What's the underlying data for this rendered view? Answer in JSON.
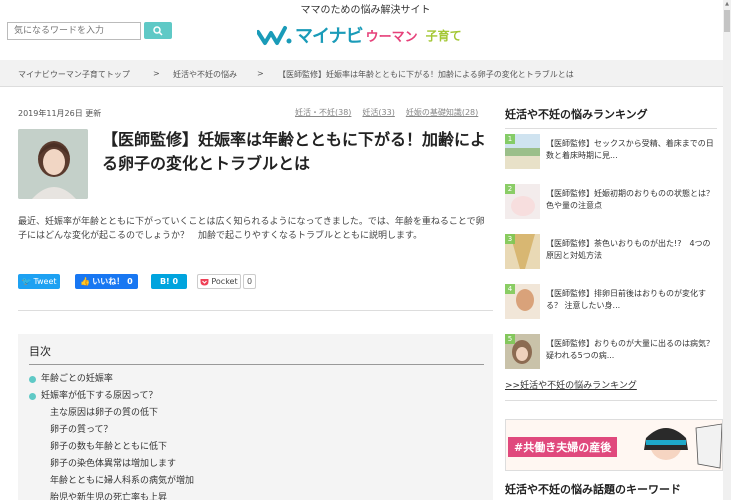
{
  "header": {
    "tagline": "ママのための悩み解決サイト",
    "search_placeholder": "気になるワードを入力",
    "logo_main": "マイナビ",
    "logo_woman": "ウーマン",
    "logo_kosodate": "子育て"
  },
  "breadcrumb": [
    "マイナビウーマン子育てトップ",
    ">",
    "妊活や不妊の悩み",
    ">",
    "【医師監修】妊娠率は年齢とともに下がる！加齢による卵子の変化とトラブルとは"
  ],
  "article": {
    "date": "2019年11月26日 更新",
    "tags": [
      "妊活・不妊(38)",
      "妊活(33)",
      "妊娠の基礎知識(28)"
    ],
    "title": "【医師監修】妊娠率は年齢とともに下がる！加齢による卵子の変化とトラブルとは",
    "lead": "最近、妊娠率が年齢とともに下がっていくことは広く知られるようになってきました。では、年齢を重ねることで卵子にはどんな変化が起こるのでしょうか？　加齢で起こりやすくなるトラブルとともに説明します。"
  },
  "share": {
    "tweet": "Tweet",
    "like": "いいね！ 0",
    "hatena": "B! 0",
    "pocket": "Pocket",
    "pocket_count": "0"
  },
  "toc": {
    "title": "目次",
    "items": [
      {
        "label": "年齢ごとの妊娠率",
        "level": 1
      },
      {
        "label": "妊娠率が低下する原因って？",
        "level": 1
      },
      {
        "label": "主な原因は卵子の質の低下",
        "level": 2
      },
      {
        "label": "卵子の質って？",
        "level": 2
      },
      {
        "label": "卵子の数も年齢とともに低下",
        "level": 2
      },
      {
        "label": "卵子の染色体異常は増加します",
        "level": 2
      },
      {
        "label": "年齢とともに婦人科系の病気が増加",
        "level": 2
      },
      {
        "label": "胎児や新生児の死亡率も上昇",
        "level": 2
      }
    ]
  },
  "sidebar": {
    "ranking_title": "妊活や不妊の悩みランキング",
    "ranking": [
      {
        "num": "1",
        "text": "【医師監修】セックスから受精、着床までの日数と着床時期に見..."
      },
      {
        "num": "2",
        "text": "【医師監修】妊娠初期のおりものの状態とは？色や量の注意点"
      },
      {
        "num": "3",
        "text": "【医師監修】茶色いおりものが出た!?　4つの原因と対処方法"
      },
      {
        "num": "4",
        "text": "【医師監修】排卵日前後はおりものが変化する？ 注意したい身..."
      },
      {
        "num": "5",
        "text": "【医師監修】おりものが大量に出るのは病気？疑われる5つの病..."
      }
    ],
    "ranking_more": ">>妊活や不妊の悩みランキング",
    "banner_label": "#共働き夫婦の産後",
    "keyword_title": "妊活や不妊の悩み話題のキーワード"
  },
  "colors": {
    "accent": "#5fc9c6",
    "brand_blue": "#1a9bb8",
    "brand_pink": "#e6417a",
    "brand_green": "#a3c734"
  }
}
